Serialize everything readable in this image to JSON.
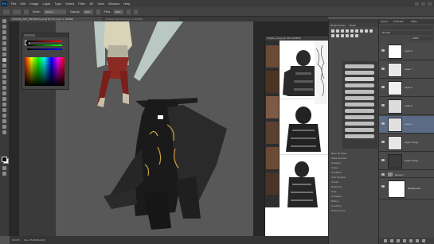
{
  "app": {
    "logo": "Ps",
    "menu": [
      "File",
      "Edit",
      "Image",
      "Layer",
      "Type",
      "Select",
      "Filter",
      "3D",
      "View",
      "Window",
      "Help"
    ]
  },
  "options": {
    "mode": "Normal",
    "opacity_label": "Opacity:",
    "opacity": "100%",
    "flow_label": "Flow:",
    "flow": "100%"
  },
  "tabs": [
    {
      "label": "CASTLE_ART_PROJECT.psd @ 66.7% (Layer 1, RGB/8)"
    },
    {
      "label": "Untitled-1 @ 50% (Layer 1, RGB/8)"
    }
  ],
  "reference_window": {
    "title": "Knights_ref.jpg @ 25% (RGB/8)"
  },
  "brush_panel": {
    "tabs": [
      "Brush Presets",
      "Brush"
    ],
    "options": [
      "Brush Tip Shape",
      "Shape Dynamics",
      "Scattering",
      "Texture",
      "Dual Brush",
      "Color Dynamics",
      "Transfer",
      "Brush Pose",
      "Noise",
      "Wet Edges",
      "Build-up",
      "Smoothing",
      "Protect Texture"
    ]
  },
  "layers_panel": {
    "tabs": [
      "Layers",
      "Channels",
      "Paths"
    ],
    "blend": "Normal",
    "opacity": "100%",
    "layers": [
      {
        "name": "Layer 6",
        "selected": false
      },
      {
        "name": "Layer 7",
        "selected": false
      },
      {
        "name": "Layer 2",
        "selected": false
      },
      {
        "name": "Layer 4",
        "selected": false
      },
      {
        "name": "Layer 1",
        "selected": true
      },
      {
        "name": "Layer 5 copy",
        "selected": false
      },
      {
        "name": "Layer 5 copy",
        "selected": false
      },
      {
        "name": "Group 1",
        "selected": false
      },
      {
        "name": "Background",
        "selected": false
      }
    ]
  },
  "status": {
    "zoom": "66.67%",
    "doc": "Doc: 25.3M/114.2M"
  }
}
